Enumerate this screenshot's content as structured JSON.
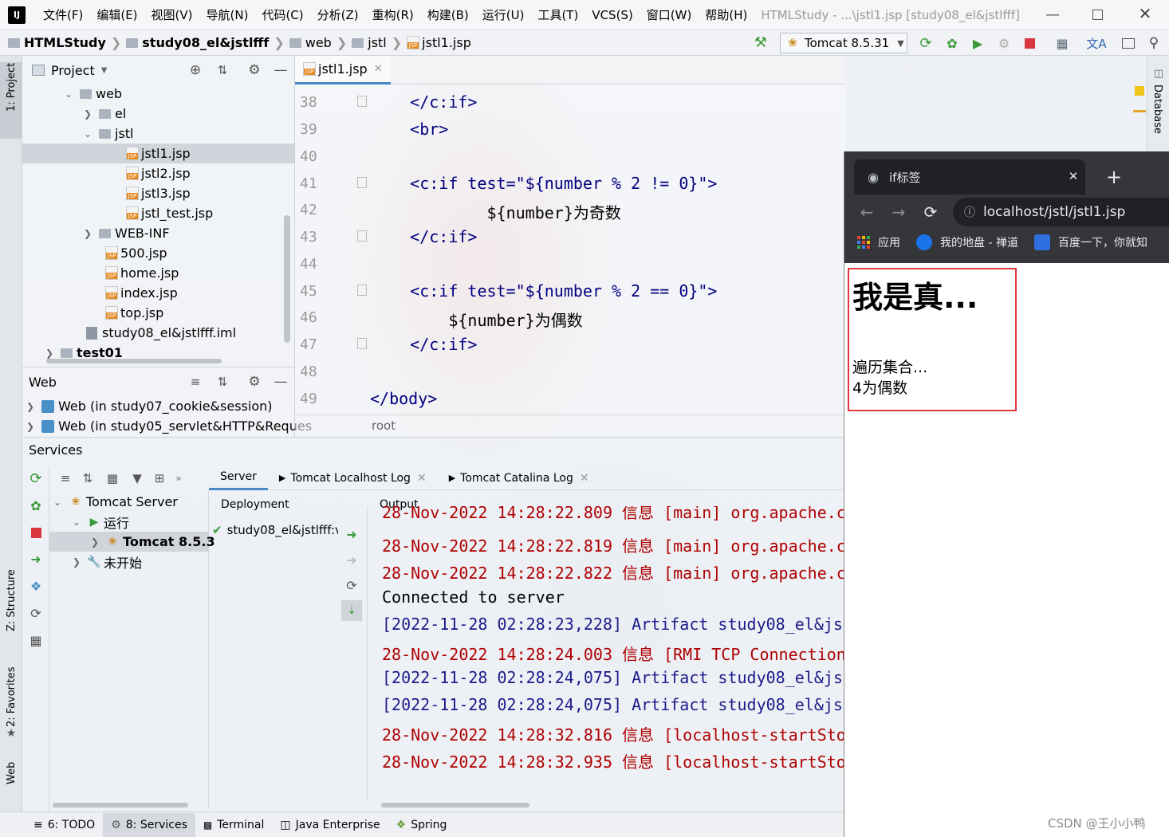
{
  "window": {
    "title": "HTMLStudy - ...\\jstl1.jsp [study08_el&jstlfff]",
    "menu": [
      "文件(F)",
      "编辑(E)",
      "视图(V)",
      "导航(N)",
      "代码(C)",
      "分析(Z)",
      "重构(R)",
      "构建(B)",
      "运行(U)",
      "工具(T)",
      "VCS(S)",
      "窗口(W)",
      "帮助(H)"
    ]
  },
  "breadcrumb": [
    "HTMLStudy",
    "study08_el&jstlfff",
    "web",
    "jstl",
    "jstl1.jsp"
  ],
  "run_config": "Tomcat 8.5.31",
  "left_strip": {
    "project": "1: Project",
    "structure": "Z: Structure",
    "favorites": "2: Favorites",
    "web": "Web"
  },
  "project_panel": {
    "title": "Project",
    "tree": [
      {
        "label": "web",
        "type": "folder",
        "expanded": true
      },
      {
        "label": "el",
        "type": "folder",
        "expanded": false
      },
      {
        "label": "jstl",
        "type": "folder",
        "expanded": true
      },
      {
        "label": "jstl1.jsp",
        "type": "jsp",
        "selected": true
      },
      {
        "label": "jstl2.jsp",
        "type": "jsp"
      },
      {
        "label": "jstl3.jsp",
        "type": "jsp"
      },
      {
        "label": "jstl_test.jsp",
        "type": "jsp"
      },
      {
        "label": "WEB-INF",
        "type": "folder",
        "expanded": false
      },
      {
        "label": "500.jsp",
        "type": "jsp"
      },
      {
        "label": "home.jsp",
        "type": "jsp"
      },
      {
        "label": "index.jsp",
        "type": "jsp"
      },
      {
        "label": "top.jsp",
        "type": "jsp"
      },
      {
        "label": "study08_el&jstlfff.iml",
        "type": "iml"
      },
      {
        "label": "test01",
        "type": "module",
        "expanded": false
      }
    ]
  },
  "web_panel": {
    "title": "Web",
    "items": [
      "Web (in study07_cookie&session)",
      "Web (in study05_servlet&HTTP&Reques"
    ]
  },
  "editor": {
    "tab": "jstl1.jsp",
    "breadcrumb": "root",
    "lines": [
      {
        "n": "38",
        "code": "    </c:if>"
      },
      {
        "n": "39",
        "code": "    <br>"
      },
      {
        "n": "40",
        "code": ""
      },
      {
        "n": "41",
        "code": "    <c:if test=\"${number % 2 != 0}\">"
      },
      {
        "n": "42",
        "code": "            ${number}为奇数"
      },
      {
        "n": "43",
        "code": "    </c:if>"
      },
      {
        "n": "44",
        "code": ""
      },
      {
        "n": "45",
        "code": "    <c:if test=\"${number % 2 == 0}\">"
      },
      {
        "n": "46",
        "code": "        ${number}为偶数"
      },
      {
        "n": "47",
        "code": "    </c:if>"
      },
      {
        "n": "48",
        "code": ""
      },
      {
        "n": "49",
        "code": "</body>"
      }
    ]
  },
  "right_strip": {
    "database": "Database"
  },
  "services": {
    "title": "Services",
    "tree": [
      {
        "label": "Tomcat Server"
      },
      {
        "label": "运行"
      },
      {
        "label": "Tomcat 8.5.3"
      },
      {
        "label": "未开始"
      }
    ],
    "tabs": [
      "Server",
      "Tomcat Localhost Log",
      "Tomcat Catalina Log"
    ],
    "deployment_header": "Deployment",
    "output_header": "Output",
    "deployment_item": "study08_el&jstlfff:v",
    "log": [
      {
        "text": "28-Nov-2022 14:28:22.809 信息 [main] org.apache.c",
        "color": "red"
      },
      {
        "text": "28-Nov-2022 14:28:22.819 信息 [main] org.apache.c",
        "color": "red"
      },
      {
        "text": "28-Nov-2022 14:28:22.822 信息 [main] org.apache.c",
        "color": "red"
      },
      {
        "text": "Connected to server",
        "color": "black"
      },
      {
        "text": "[2022-11-28 02:28:23,228] Artifact study08_el&js",
        "color": "blue"
      },
      {
        "text": "28-Nov-2022 14:28:24.003 信息 [RMI TCP Connection",
        "color": "red"
      },
      {
        "text": "[2022-11-28 02:28:24,075] Artifact study08_el&js",
        "color": "blue"
      },
      {
        "text": "[2022-11-28 02:28:24,075] Artifact study08_el&js",
        "color": "blue"
      },
      {
        "text": "28-Nov-2022 14:28:32.816 信息 [localhost-startSto",
        "color": "red"
      },
      {
        "text": "28-Nov-2022 14:28:32.935 信息 [localhost-startSto",
        "color": "red"
      }
    ]
  },
  "bottom_tabs": [
    {
      "label": "6: TODO"
    },
    {
      "label": "8: Services",
      "active": true
    },
    {
      "label": "Terminal"
    },
    {
      "label": "Java Enterprise"
    },
    {
      "label": "Spring"
    }
  ],
  "browser": {
    "tab_title": "if标签",
    "url": "localhost/jstl/jstl1.jsp",
    "bookmarks": [
      "应用",
      "我的地盘 - 禅道",
      "百度一下，你就知"
    ],
    "page_heading": "我是真...",
    "page_lines": [
      "遍历集合...",
      "4为偶数"
    ]
  },
  "watermark": "CSDN @王小小鸭"
}
